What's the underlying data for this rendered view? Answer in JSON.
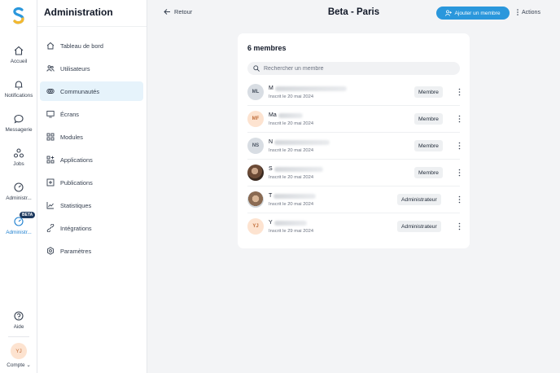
{
  "rail": {
    "items": [
      {
        "label": "Accueil",
        "icon": "home-icon"
      },
      {
        "label": "Notifications",
        "icon": "bell-icon"
      },
      {
        "label": "Messagerie",
        "icon": "chat-icon"
      },
      {
        "label": "Jobs",
        "icon": "jobs-icon"
      },
      {
        "label": "Administr...",
        "icon": "gauge-icon"
      },
      {
        "label": "Administr...",
        "icon": "gauge-icon",
        "badge": "BETA"
      }
    ],
    "help_label": "Aide",
    "account_initials": "YJ",
    "account_label": "Compte"
  },
  "sidebar": {
    "title": "Administration",
    "items": [
      {
        "label": "Tableau de bord",
        "icon": "home-icon"
      },
      {
        "label": "Utilisateurs",
        "icon": "users-icon"
      },
      {
        "label": "Communautés",
        "icon": "communities-icon"
      },
      {
        "label": "Écrans",
        "icon": "screen-icon"
      },
      {
        "label": "Modules",
        "icon": "grid-icon"
      },
      {
        "label": "Applications",
        "icon": "apps-icon"
      },
      {
        "label": "Publications",
        "icon": "publication-icon"
      },
      {
        "label": "Statistiques",
        "icon": "chart-icon"
      },
      {
        "label": "Intégrations",
        "icon": "integration-icon"
      },
      {
        "label": "Paramètres",
        "icon": "settings-icon"
      }
    ]
  },
  "header": {
    "back_label": "Retour",
    "title": "Beta - Paris",
    "add_member_label": "Ajouter un membre",
    "actions_label": "Actions"
  },
  "members_card": {
    "title": "6 membres",
    "search_placeholder": "Rechercher un membre",
    "members": [
      {
        "initials": "ML",
        "name": "M",
        "joined": "Inscrit le 20 mai 2024",
        "role": "Membre",
        "avatar": "gray"
      },
      {
        "initials": "MF",
        "name": "Ma",
        "joined": "Inscrit le 20 mai 2024",
        "role": "Membre",
        "avatar": "peach"
      },
      {
        "initials": "NS",
        "name": "N",
        "joined": "Inscrit le 20 mai 2024",
        "role": "Membre",
        "avatar": "gray"
      },
      {
        "initials": "",
        "name": "S",
        "joined": "Inscrit le 20 mai 2024",
        "role": "Membre",
        "avatar": "photo1"
      },
      {
        "initials": "",
        "name": "T",
        "joined": "Inscrit le 20 mai 2024",
        "role": "Administrateur",
        "avatar": "photo2"
      },
      {
        "initials": "YJ",
        "name": "Y",
        "joined": "Inscrit le 29 mai 2024",
        "role": "Administrateur",
        "avatar": "peach"
      }
    ]
  },
  "colors": {
    "accent": "#2a97dc",
    "active_bg": "#e6f3fb",
    "badge": "#1e3a5f"
  }
}
